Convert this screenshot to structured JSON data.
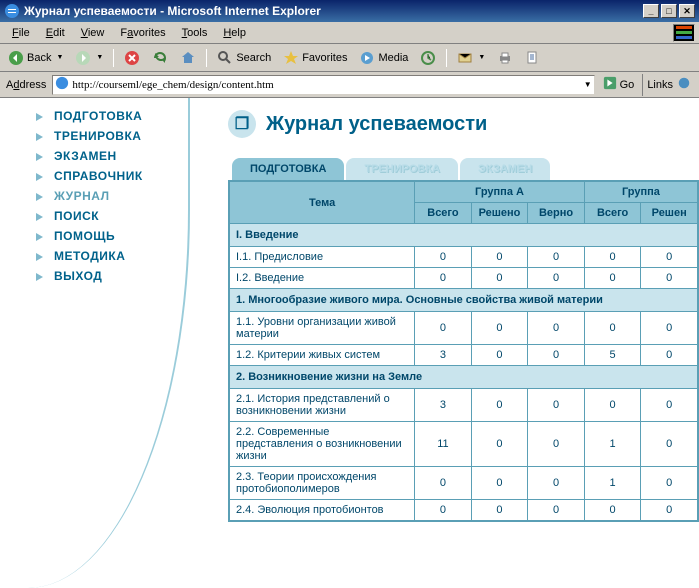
{
  "window": {
    "title": "Журнал успеваемости - Microsoft Internet Explorer"
  },
  "menubar": {
    "file": "File",
    "edit": "Edit",
    "view": "View",
    "favorites": "Favorites",
    "tools": "Tools",
    "help": "Help"
  },
  "toolbar": {
    "back": "Back",
    "search": "Search",
    "favorites": "Favorites",
    "media": "Media"
  },
  "address": {
    "label": "Address",
    "url": "http://courseml/ege_chem/design/content.htm",
    "go": "Go",
    "links": "Links"
  },
  "sidebar": {
    "items": [
      {
        "label": "ПОДГОТОВКА",
        "active": false
      },
      {
        "label": "ТРЕНИРОВКА",
        "active": false
      },
      {
        "label": "ЭКЗАМЕН",
        "active": false
      },
      {
        "label": "СПРАВОЧНИК",
        "active": false
      },
      {
        "label": "ЖУРНАЛ",
        "active": true
      },
      {
        "label": "ПОИСК",
        "active": false
      },
      {
        "label": "ПОМОЩЬ",
        "active": false
      },
      {
        "label": "МЕТОДИКА",
        "active": false
      },
      {
        "label": "ВЫХОД",
        "active": false
      }
    ]
  },
  "page": {
    "title": "Журнал успеваемости",
    "tabs": [
      {
        "label": "ПОДГОТОВКА",
        "active": true
      },
      {
        "label": "ТРЕНИРОВКА",
        "active": false
      },
      {
        "label": "ЭКЗАМЕН",
        "active": false
      }
    ]
  },
  "table": {
    "headers": {
      "tema": "Тема",
      "group_a": "Группа А",
      "group_b": "Группа",
      "vsego": "Всего",
      "resheno": "Решено",
      "verno": "Верно",
      "vsego2": "Всего",
      "resheno2": "Решен"
    },
    "rows": [
      {
        "type": "section",
        "label": "I. Введение"
      },
      {
        "type": "data",
        "tema": "I.1. Предисловие",
        "a_vsego": "0",
        "a_resheno": "0",
        "a_verno": "0",
        "b_vsego": "0",
        "b_resheno": "0"
      },
      {
        "type": "data",
        "tema": "I.2. Введение",
        "a_vsego": "0",
        "a_resheno": "0",
        "a_verno": "0",
        "b_vsego": "0",
        "b_resheno": "0"
      },
      {
        "type": "section",
        "label": "1. Многообразие живого мира. Основные свойства живой материи"
      },
      {
        "type": "data",
        "tema": "1.1. Уровни организации живой материи",
        "a_vsego": "0",
        "a_resheno": "0",
        "a_verno": "0",
        "b_vsego": "0",
        "b_resheno": "0"
      },
      {
        "type": "data",
        "tema": "1.2. Критерии живых систем",
        "a_vsego": "3",
        "a_resheno": "0",
        "a_verno": "0",
        "b_vsego": "5",
        "b_resheno": "0"
      },
      {
        "type": "section",
        "label": "2. Возникновение жизни на Земле"
      },
      {
        "type": "data",
        "tema": "2.1. История представлений о возникновении жизни",
        "a_vsego": "3",
        "a_resheno": "0",
        "a_verno": "0",
        "b_vsego": "0",
        "b_resheno": "0"
      },
      {
        "type": "data",
        "tema": "2.2. Современные представления о возникновении жизни",
        "a_vsego": "11",
        "a_resheno": "0",
        "a_verno": "0",
        "b_vsego": "1",
        "b_resheno": "0"
      },
      {
        "type": "data",
        "tema": "2.3. Теории происхождения протобиополимеров",
        "a_vsego": "0",
        "a_resheno": "0",
        "a_verno": "0",
        "b_vsego": "1",
        "b_resheno": "0"
      },
      {
        "type": "data",
        "tema": "2.4. Эволюция протобионтов",
        "a_vsego": "0",
        "a_resheno": "0",
        "a_verno": "0",
        "b_vsego": "0",
        "b_resheno": "0"
      }
    ]
  }
}
